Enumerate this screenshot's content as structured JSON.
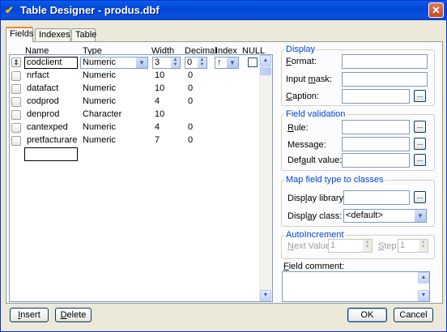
{
  "window": {
    "title": "Table Designer - produs.dbf",
    "close_label": "✕"
  },
  "tabs": [
    {
      "label": "Fields"
    },
    {
      "label": "Indexes"
    },
    {
      "label": "Table"
    }
  ],
  "grid": {
    "headers": {
      "name": "Name",
      "type": "Type",
      "width": "Width",
      "decimal": "Decimal",
      "index": "Index",
      "null": "NULL"
    },
    "rows": [
      {
        "name": "codclient",
        "type": "Numeric",
        "width": "3",
        "decimal": "0"
      },
      {
        "name": "nrfact",
        "type": "Numeric",
        "width": "10",
        "decimal": "0"
      },
      {
        "name": "datafact",
        "type": "Numeric",
        "width": "10",
        "decimal": "0"
      },
      {
        "name": "codprod",
        "type": "Numeric",
        "width": "4",
        "decimal": "0"
      },
      {
        "name": "denprod",
        "type": "Character",
        "width": "10",
        "decimal": ""
      },
      {
        "name": "cantexped",
        "type": "Numeric",
        "width": "4",
        "decimal": "0"
      },
      {
        "name": "pretfacturare",
        "type": "Numeric",
        "width": "7",
        "decimal": "0"
      }
    ],
    "selected_index_symbol": "↑"
  },
  "display": {
    "title": "Display",
    "format": {
      "pre": "",
      "key": "F",
      "post": "ormat:"
    },
    "input_mask": {
      "pre": "Input ",
      "key": "m",
      "post": "ask:"
    },
    "caption": {
      "pre": "",
      "key": "C",
      "post": "aption:"
    }
  },
  "validation": {
    "title": "Field validation",
    "rule": {
      "pre": "",
      "key": "R",
      "post": "ule:"
    },
    "message": {
      "pre": "Message:",
      "key": "",
      "post": ""
    },
    "default_value": {
      "pre": "Def",
      "key": "a",
      "post": "ult value:"
    }
  },
  "mapping": {
    "title": "Map field type to classes",
    "display_library": {
      "pre": "Disp",
      "key": "l",
      "post": "ay library:"
    },
    "display_class": {
      "pre": "Displ",
      "key": "a",
      "post": "y class:"
    },
    "display_class_value": "<default>"
  },
  "autoincrement": {
    "title": "AutoIncrement",
    "next_value": {
      "pre": "",
      "key": "N",
      "post": "ext Value:"
    },
    "next_value_val": "1",
    "step": {
      "pre": "",
      "key": "S",
      "post": "tep:"
    },
    "step_val": "1"
  },
  "comment": {
    "label": {
      "pre": "",
      "key": "F",
      "post": "ield comment:"
    }
  },
  "buttons": {
    "insert": {
      "pre": "",
      "key": "I",
      "post": "nsert"
    },
    "delete": {
      "pre": "",
      "key": "D",
      "post": "elete"
    },
    "ok": "OK",
    "cancel": "Cancel",
    "ellipsis": "..."
  }
}
